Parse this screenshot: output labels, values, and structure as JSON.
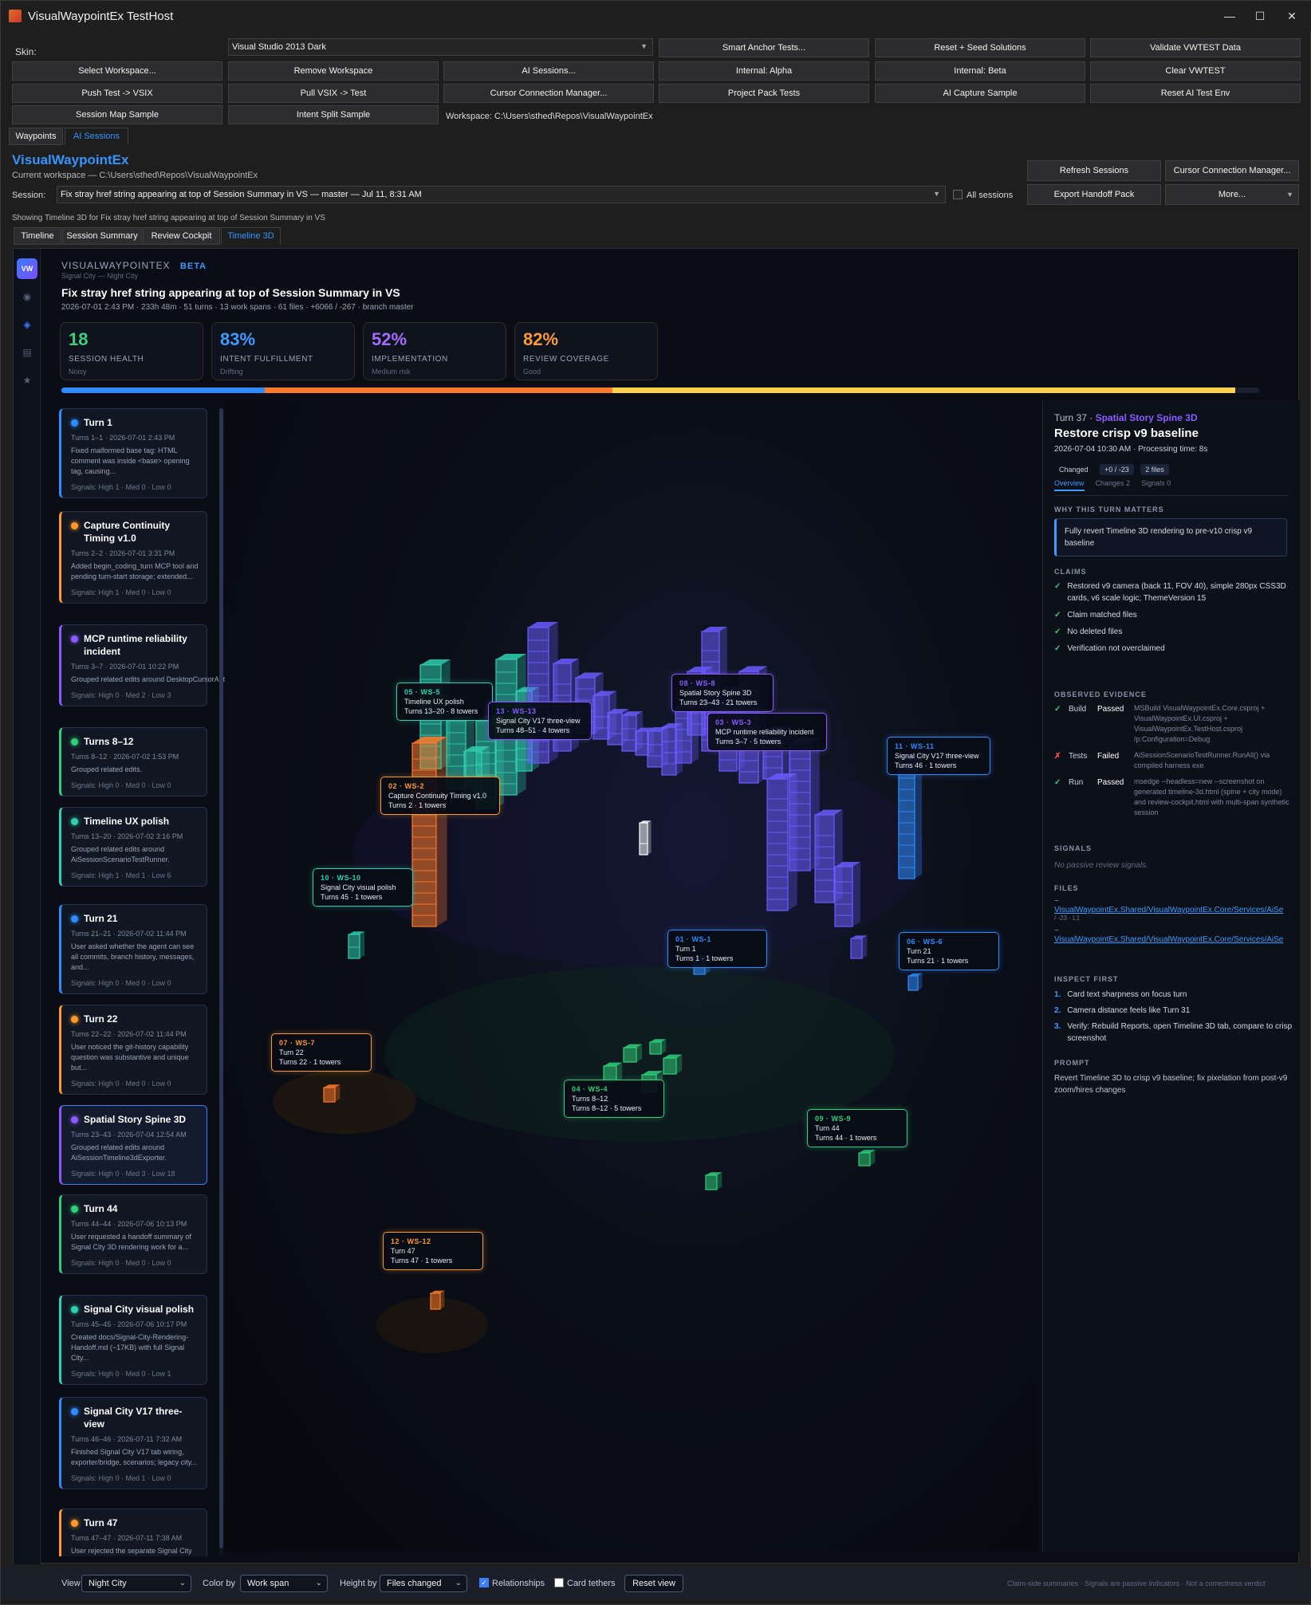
{
  "window": {
    "title": "VisualWaypointEx TestHost",
    "minimize": "—",
    "maximize": "☐",
    "close": "✕"
  },
  "toolbar": {
    "skin_label": "Skin:",
    "skin_value": "Visual Studio 2013 Dark",
    "buttons": [
      "Smart Anchor Tests...",
      "Reset + Seed Solutions",
      "Validate VWTEST Data",
      "Select Workspace...",
      "Remove Workspace",
      "AI Sessions...",
      "Internal: Alpha",
      "Internal: Beta",
      "Clear VWTEST",
      "Push Test -> VSIX",
      "Pull VSIX -> Test",
      "Cursor Connection Manager...",
      "Project Pack Tests",
      "AI Capture Sample",
      "Reset AI Test Env",
      "Session Map Sample",
      "Intent Split Sample"
    ],
    "workspace_path": "Workspace: C:\\Users\\sthed\\Repos\\VisualWaypointEx"
  },
  "outer_tabs": [
    "Waypoints",
    "AI Sessions"
  ],
  "header": {
    "title": "VisualWaypointEx",
    "subtitle": "Current workspace — C:\\Users\\sthed\\Repos\\VisualWaypointEx",
    "session_label": "Session:",
    "session_value": "Fix stray href string appearing at top of Session Summary in VS — master — Jul 11, 8:31 AM",
    "all_sessions": "All sessions",
    "buttons": [
      "Refresh Sessions",
      "Cursor Connection Manager...",
      "Export Handoff Pack",
      "More..."
    ],
    "showing": "Showing Timeline 3D for Fix stray href string appearing at top of Session Summary in VS"
  },
  "inner_tabs": [
    "Timeline",
    "Session Summary",
    "Review Cockpit",
    "Timeline 3D"
  ],
  "dash": {
    "brand": "VISUALWAYPOINTEX",
    "beta": "BETA",
    "mode": "Signal City — Night City",
    "title": "Fix stray href string appearing at top of Session Summary in VS",
    "meta": "2026-07-01 2:43 PM · 233h 48m · 51 turns · 13 work spans · 61 files · +6066 / -267 · branch master",
    "kpis": [
      {
        "value": "18",
        "label": "SESSION HEALTH",
        "sub": "Noisy",
        "color": "#3fd07a"
      },
      {
        "value": "83%",
        "label": "INTENT FULFILLMENT",
        "sub": "Drifting",
        "color": "#3f9bff"
      },
      {
        "value": "52%",
        "label": "IMPLEMENTATION",
        "sub": "Medium risk",
        "color": "#a56bff"
      },
      {
        "value": "82%",
        "label": "REVIEW COVERAGE",
        "sub": "Good",
        "color": "#ff9a3c"
      }
    ],
    "progress_segments": [
      {
        "fraction": 0.17,
        "color": "#2f8cff"
      },
      {
        "fraction": 0.29,
        "color": "#ff7a2a"
      },
      {
        "fraction": 0.52,
        "color": "#ffd24a"
      }
    ]
  },
  "turns": [
    {
      "name": "Turn 1",
      "meta": "Turns 1–1 · 2026-07-01 2:43 PM",
      "desc": "Fixed malformed base tag: HTML comment was inside <base> opening tag, causing...",
      "signals": "Signals: High 1 · Med 0 · Low 0",
      "color": "#2f8cff"
    },
    {
      "name": "Capture Continuity Timing v1.0",
      "meta": "Turns 2–2 · 2026-07-01 3:31 PM",
      "desc": "Added begin_coding_turn MCP tool and pending turn-start storage; extended...",
      "signals": "Signals: High 1 · Med 0 · Low 0",
      "color": "#ff9a2a"
    },
    {
      "name": "MCP runtime reliability incident",
      "meta": "Turns 3–7 · 2026-07-01 10:22 PM",
      "desc": "Grouped related edits around DesktopCursorAutomationScenarioRunne",
      "signals": "Signals: High 0 · Med 2 · Low 3",
      "color": "#8a5cff"
    },
    {
      "name": "Turns 8–12",
      "meta": "Turns 8–12 · 2026-07-02 1:53 PM",
      "desc": "Grouped related edits.",
      "signals": "Signals: High 0 · Med 0 · Low 0",
      "color": "#2fd07a"
    },
    {
      "name": "Timeline UX polish",
      "meta": "Turns 13–20 · 2026-07-02 3:16 PM",
      "desc": "Grouped related edits around AiSessionScenarioTestRunner.",
      "signals": "Signals: High 1 · Med 1 · Low 6",
      "color": "#2fd0b0"
    },
    {
      "name": "Turn 21",
      "meta": "Turns 21–21 · 2026-07-02 11:44 PM",
      "desc": "User asked whether the agent can see all commits, branch history, messages, and...",
      "signals": "Signals: High 0 · Med 0 · Low 0",
      "color": "#2f8cff"
    },
    {
      "name": "Turn 22",
      "meta": "Turns 22–22 · 2026-07-02 11:44 PM",
      "desc": "User noticed the git-history capability question was substantive and unique but...",
      "signals": "Signals: High 0 · Med 0 · Low 0",
      "color": "#ff9a2a"
    },
    {
      "name": "Spatial Story Spine 3D",
      "meta": "Turns 23–43 · 2026-07-04 12:54 AM",
      "desc": "Grouped related edits around AiSessionTimeline3dExporter.",
      "signals": "Signals: High 0 · Med 3 · Low 18",
      "color": "#8a5cff"
    },
    {
      "name": "Turn 44",
      "meta": "Turns 44–44 · 2026-07-06 10:13 PM",
      "desc": "User requested a handoff summary of Signal City 3D rendering work for a...",
      "signals": "Signals: High 0 · Med 0 · Low 0",
      "color": "#2fd07a"
    },
    {
      "name": "Signal City visual polish",
      "meta": "Turns 45–45 · 2026-07-06 10:17 PM",
      "desc": "Created docs/Signal-City-Rendering-Handoff.md (~17KB) with full Signal City...",
      "signals": "Signals: High 0 · Med 0 · Low 1",
      "color": "#2fd0b0"
    },
    {
      "name": "Signal City V17 three-view",
      "meta": "Turns 46–46 · 2026-07-11 7:32 AM",
      "desc": "Finished Signal City V17 tab wiring, exporter/bridge, scenarios; legacy city...",
      "signals": "Signals: High 0 · Med 1 · Low 0",
      "color": "#2f8cff"
    },
    {
      "name": "Turn 47",
      "meta": "Turns 47–47 · 2026-07-11 7:38 AM",
      "desc": "User rejected the separate Signal City tab. Correct integration is:",
      "signals": "",
      "color": "#ff9a2a"
    }
  ],
  "spans": [
    {
      "code": "05 · WS-5",
      "name": "Timeline UX polish",
      "sub": "Turns 13–20 · 8 towers",
      "color": "#2fd0b0"
    },
    {
      "code": "13 · WS-13",
      "name": "Signal City V17 three-view",
      "sub": "Turns 48–51 · 4 towers",
      "color": "#8a5cff"
    },
    {
      "code": "08 · WS-8",
      "name": "Spatial Story Spine 3D",
      "sub": "Turns 23–43 · 21 towers",
      "color": "#8a5cff"
    },
    {
      "code": "03 · WS-3",
      "name": "MCP runtime reliability incident",
      "sub": "Turns 3–7 · 5 towers",
      "color": "#8a5cff"
    },
    {
      "code": "02 · WS-2",
      "name": "Capture Continuity Timing v1.0",
      "sub": "Turns 2 · 1 towers",
      "color": "#ff9a2a"
    },
    {
      "code": "11 · WS-11",
      "name": "Signal City V17 three-view",
      "sub": "Turns 46 · 1 towers",
      "color": "#2f8cff"
    },
    {
      "code": "10 · WS-10",
      "name": "Signal City visual polish",
      "sub": "Turns 45 · 1 towers",
      "color": "#2fd0b0"
    },
    {
      "code": "01 · WS-1",
      "name": "Turn 1",
      "sub": "Turns 1 · 1 towers",
      "color": "#2f8cff"
    },
    {
      "code": "06 · WS-6",
      "name": "Turn 21",
      "sub": "Turns 21 · 1 towers",
      "color": "#2f8cff"
    },
    {
      "code": "07 · WS-7",
      "name": "Turn 22",
      "sub": "Turns 22 · 1 towers",
      "color": "#ff9a2a"
    },
    {
      "code": "04 · WS-4",
      "name": "Turns 8–12",
      "sub": "Turns 8–12 · 5 towers",
      "color": "#2fd07a"
    },
    {
      "code": "09 · WS-9",
      "name": "Turn 44",
      "sub": "Turns 44 · 1 towers",
      "color": "#2fd07a"
    },
    {
      "code": "12 · WS-12",
      "name": "Turn 47",
      "sub": "Turns 47 · 1 towers",
      "color": "#ff9a2a"
    }
  ],
  "detail": {
    "turn": "Turn 37 · ",
    "span": "Spatial Story Spine 3D",
    "title": "Restore crisp v9 baseline",
    "when": "2026-07-04 10:30 AM · Processing time: 8s",
    "chips": [
      "Changed",
      "+0 / -23",
      "2 files"
    ],
    "tabs": [
      "Overview",
      "Changes 2",
      "Signals 0"
    ],
    "why_label": "WHY THIS TURN MATTERS",
    "why": "Fully revert Timeline 3D rendering to pre-v10 crisp v9 baseline",
    "claims_label": "CLAIMS",
    "claims": [
      "Restored v9 camera (back 11, FOV 40), simple 280px CSS3D cards, v6 scale logic; ThemeVersion 15",
      "Claim matched files",
      "No deleted files",
      "Verification not overclaimed"
    ],
    "evidence_label": "OBSERVED EVIDENCE",
    "evidence": [
      {
        "mark": "✓",
        "kind": "Build",
        "status": "Passed",
        "text": "MSBuild VisualWaypointEx.Core.csproj + VisualWaypointEx.UI.csproj + VisualWaypointEx.TestHost.csproj /p:Configuration=Debug",
        "color": "#3fd07a"
      },
      {
        "mark": "✗",
        "kind": "Tests",
        "status": "Failed",
        "text": "AiSessionScenarioTestRunner.RunAll() via compiled harness exe",
        "color": "#ff4a4a"
      },
      {
        "mark": "✓",
        "kind": "Run",
        "status": "Passed",
        "text": "msedge --headless=new --screenshot on generated timeline-3d.html (spine + city mode) and review-cockpit.html with multi-span synthetic session",
        "color": "#3fd07a"
      }
    ],
    "signals_label": "SIGNALS",
    "signals": "No passive review signals.",
    "files_label": "FILES",
    "files": [
      {
        "mark": "~",
        "path": "VisualWaypointEx.Shared/VisualWaypointEx.Core/Services/AiSe",
        "stat": "/ -23 · L1"
      },
      {
        "mark": "~",
        "path": "VisualWaypointEx.Shared/VisualWaypointEx.Core/Services/AiSe",
        "stat": ""
      }
    ],
    "inspect_label": "INSPECT FIRST",
    "inspect": [
      "Card text sharpness on focus turn",
      "Camera distance feels like Turn 31",
      "Verify: Rebuild Reports, open Timeline 3D tab, compare to crisp screenshot"
    ],
    "prompt_label": "PROMPT",
    "prompt": "Revert Timeline 3D to crisp v9 baseline; fix pixelation from post-v9 zoom/hires changes"
  },
  "footer": {
    "view_label": "View",
    "view_value": "Night City",
    "color_label": "Color by",
    "color_value": "Work span",
    "height_label": "Height by",
    "height_value": "Files changed",
    "relationships": "Relationships",
    "tethers": "Card tethers",
    "reset": "Reset view",
    "note": "Claim-side summaries · Signals are passive indicators · Not a correctness verdict"
  }
}
